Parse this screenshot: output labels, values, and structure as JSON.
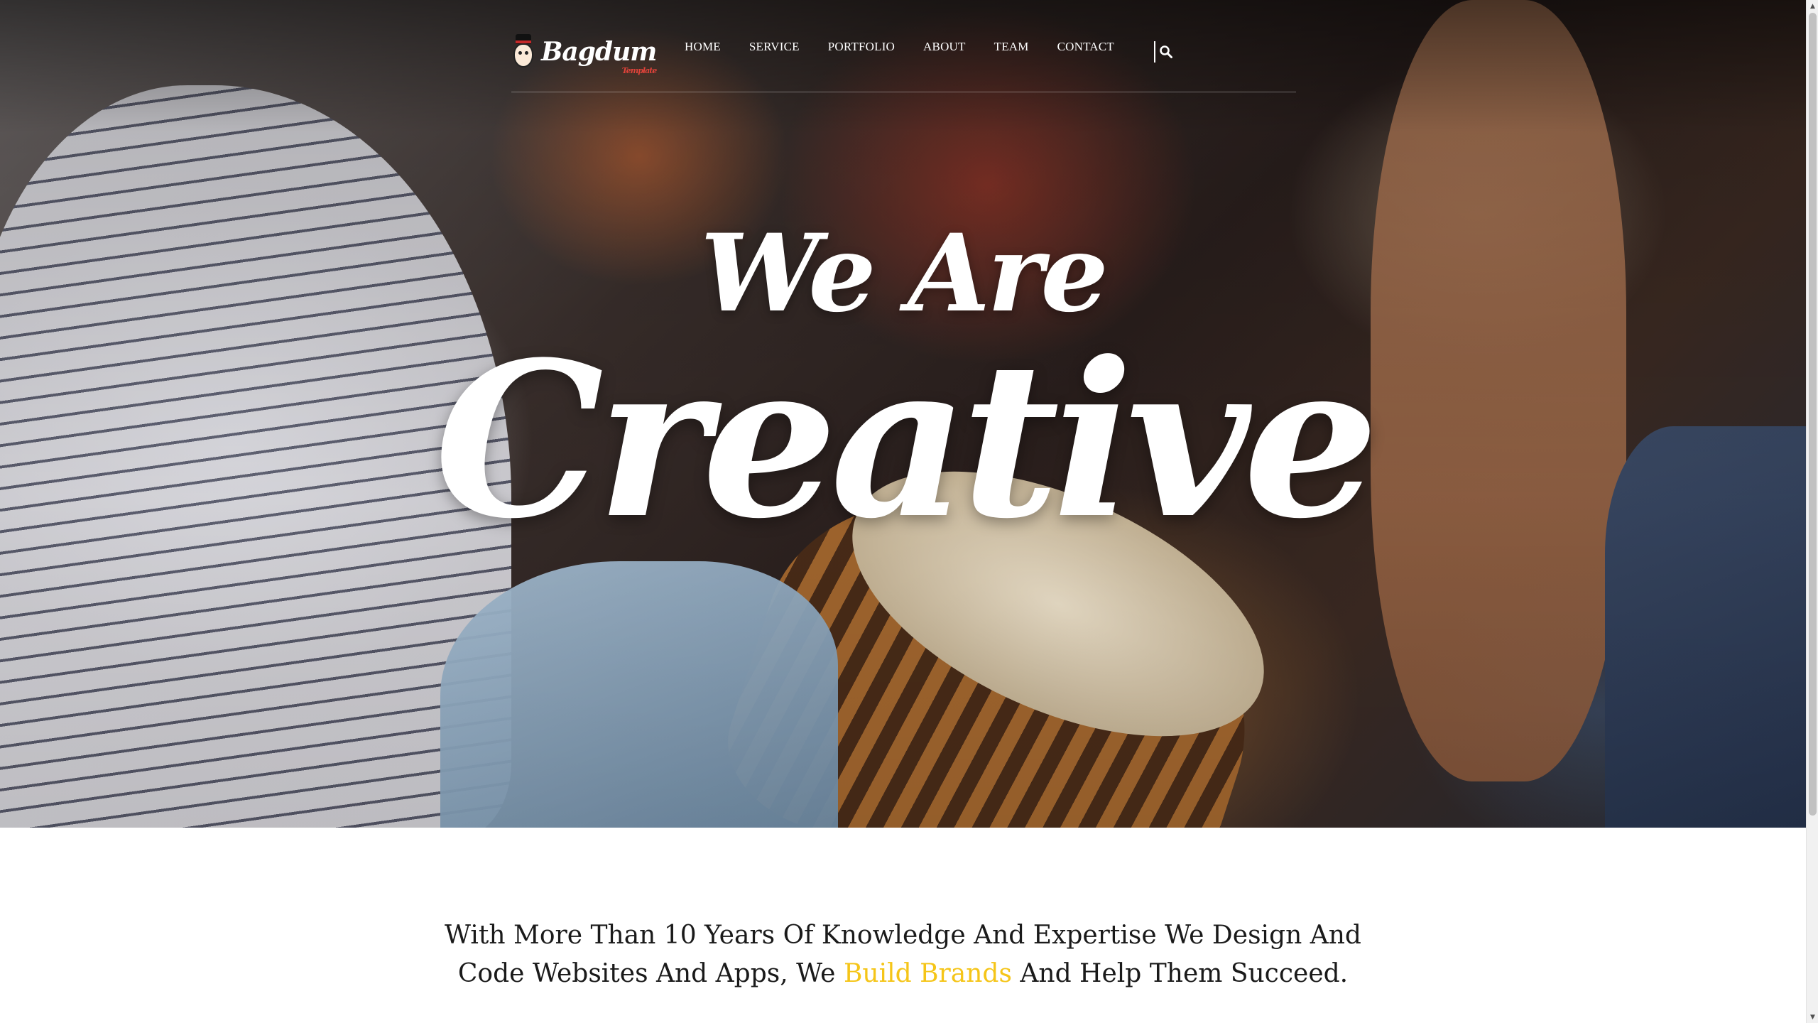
{
  "brand": {
    "name": "Bagdum",
    "tagline": "Template",
    "accent_color": "#e0433a"
  },
  "nav": {
    "items": [
      {
        "label": "HOME"
      },
      {
        "label": "SERVICE"
      },
      {
        "label": "PORTFOLIO"
      },
      {
        "label": "ABOUT"
      },
      {
        "label": "TEAM"
      },
      {
        "label": "CONTACT"
      }
    ],
    "search_icon": "search-icon"
  },
  "hero": {
    "line1": "We Are",
    "line2": "Creative"
  },
  "intro": {
    "line1": "With More Than 10 Years Of Knowledge And Expertise We Design And",
    "line2_before": "Code Websites And Apps, We ",
    "line2_highlight": "Build Brands",
    "line2_after": " And Help Them Succeed.",
    "highlight_color": "#f5c518"
  },
  "scrollbar": {
    "up_icon": "▲",
    "down_icon": "▼"
  }
}
